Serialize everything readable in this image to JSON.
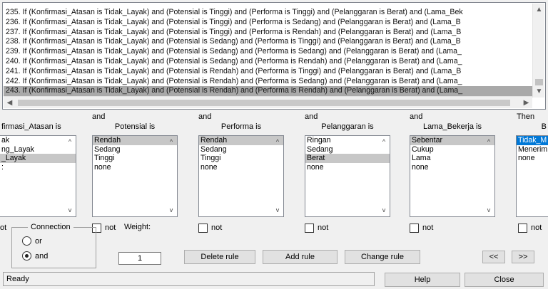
{
  "rules": [
    "235. If (Konfirmasi_Atasan is Tidak_Layak) and (Potensial is Tinggi) and (Performa is Tinggi) and (Pelanggaran is Berat) and (Lama_Bek",
    "236. If (Konfirmasi_Atasan is Tidak_Layak) and (Potensial is Tinggi) and (Performa is Sedang) and (Pelanggaran is Berat) and (Lama_B",
    "237. If (Konfirmasi_Atasan is Tidak_Layak) and (Potensial is Tinggi) and (Performa is Rendah) and (Pelanggaran is Berat) and (Lama_B",
    "238. If (Konfirmasi_Atasan is Tidak_Layak) and (Potensial is Sedang) and (Performa is Tinggi) and (Pelanggaran is Berat) and (Lama_B",
    "239. If (Konfirmasi_Atasan is Tidak_Layak) and (Potensial is Sedang) and (Performa is Sedang) and (Pelanggaran is Berat) and (Lama_",
    "240. If (Konfirmasi_Atasan is Tidak_Layak) and (Potensial is Sedang) and (Performa is Rendah) and (Pelanggaran is Berat) and (Lama_",
    "241. If (Konfirmasi_Atasan is Tidak_Layak) and (Potensial is Rendah) and (Performa is Tinggi) and (Pelanggaran is Berat) and (Lama_B",
    "242. If (Konfirmasi_Atasan is Tidak_Layak) and (Potensial is Rendah) and (Performa is Sedang) and (Pelanggaran is Berat) and (Lama_",
    "243. If (Konfirmasi_Atasan is Tidak_Layak) and (Potensial is Rendah) and (Performa is Rendah) and (Pelanggaran is Berat) and (Lama_"
  ],
  "selected_rule_index": 8,
  "columns": {
    "konfirmasi": {
      "title": "firmasi_Atasan is",
      "items": [
        "ak",
        "ng_Layak",
        "_Layak",
        ":"
      ],
      "selected": 2,
      "not_label": "ot"
    },
    "potensial": {
      "and": "and",
      "title": "Potensial is",
      "items": [
        "Rendah",
        "Sedang",
        "Tinggi",
        "none"
      ],
      "selected": 0,
      "not_label": "not"
    },
    "performa": {
      "and": "and",
      "title": "Performa is",
      "items": [
        "Rendah",
        "Sedang",
        "Tinggi",
        "none"
      ],
      "selected": 0,
      "not_label": "not"
    },
    "pelanggaran": {
      "and": "and",
      "title": "Pelanggaran is",
      "items": [
        "Ringan",
        "Sedang",
        "Berat",
        "none"
      ],
      "selected": 2,
      "not_label": "not"
    },
    "lama": {
      "and": "and",
      "title": "Lama_Bekerja is",
      "items": [
        "Sebentar",
        "Cukup",
        "Lama",
        "none"
      ],
      "selected": 0,
      "not_label": "not"
    },
    "output": {
      "and": "Then",
      "title": "B",
      "items": [
        "Tidak_M",
        "Menerim",
        "none"
      ],
      "selected": 0,
      "not_label": "not"
    }
  },
  "connection": {
    "title": "Connection",
    "or_label": "or",
    "and_label": "and",
    "selected": "and"
  },
  "weight": {
    "label": "Weight:",
    "value": "1"
  },
  "buttons": {
    "delete_rule": "Delete rule",
    "add_rule": "Add rule",
    "change_rule": "Change rule",
    "prev": "<<",
    "next": ">>",
    "help": "Help",
    "close": "Close"
  },
  "status_text": "Ready"
}
